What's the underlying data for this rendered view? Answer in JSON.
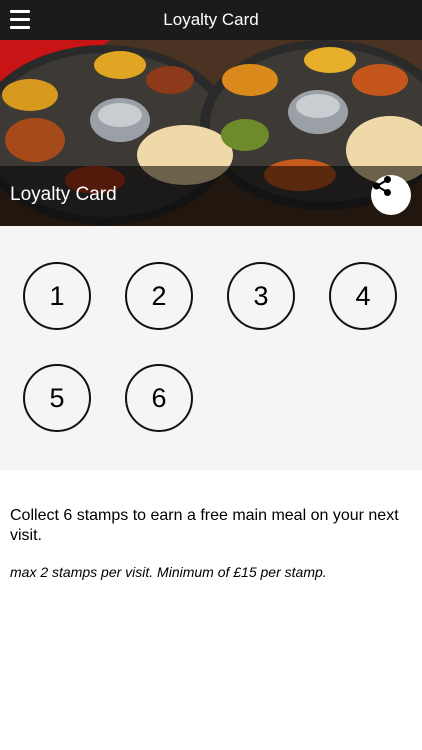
{
  "header": {
    "title": "Loyalty Card",
    "menu_icon": "hamburger-icon"
  },
  "hero": {
    "title": "Loyalty Card",
    "share_icon": "share-icon"
  },
  "stamps": [
    "1",
    "2",
    "3",
    "4",
    "5",
    "6"
  ],
  "info": {
    "description": "Collect 6 stamps to earn a free main meal on your next visit.",
    "note": "max 2 stamps per visit. Minimum of £15 per stamp."
  },
  "colors": {
    "topbar": "#1b1b1b",
    "stamp_area": "#f5f5f5",
    "stamp_border": "#111111"
  }
}
